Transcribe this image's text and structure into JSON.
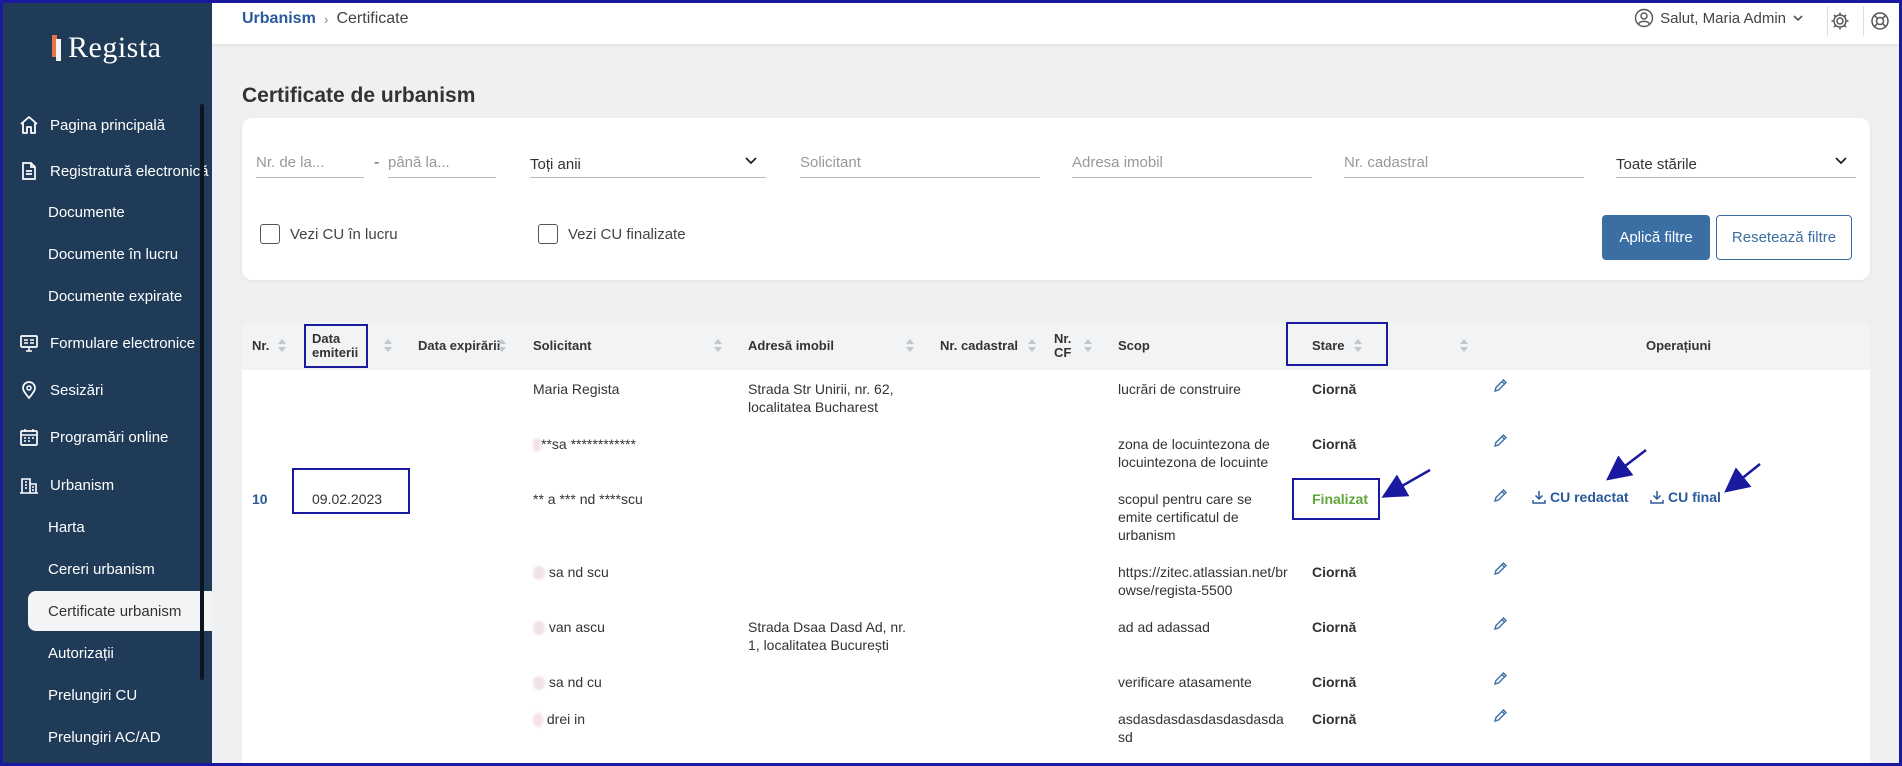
{
  "sidebar": {
    "logo": "Regista",
    "items": [
      {
        "label": "Pagina principală"
      },
      {
        "label": "Registratură electronică"
      },
      {
        "label": "Formulare electronice"
      },
      {
        "label": "Sesizări"
      },
      {
        "label": "Programări online"
      },
      {
        "label": "Urbanism"
      }
    ],
    "registry_sub": [
      {
        "label": "Documente"
      },
      {
        "label": "Documente în lucru"
      },
      {
        "label": "Documente expirate"
      }
    ],
    "urbanism_sub": [
      {
        "label": "Harta"
      },
      {
        "label": "Cereri urbanism"
      },
      {
        "label": "Certificate urbanism"
      },
      {
        "label": "Autorizații"
      },
      {
        "label": "Prelungiri CU"
      },
      {
        "label": "Prelungiri AC/AD"
      }
    ]
  },
  "header": {
    "breadcrumb_parent": "Urbanism",
    "breadcrumb_current": "Certificate",
    "user_greeting": "Salut, Maria Admin"
  },
  "page": {
    "title": "Certificate de urbanism"
  },
  "filters": {
    "nr_from_placeholder": "Nr. de la...",
    "nr_to_placeholder": "până la...",
    "dash": "-",
    "year_select": "Toți anii",
    "applicant_placeholder": "Solicitant",
    "address_placeholder": "Adresa imobil",
    "cadastral_placeholder": "Nr. cadastral",
    "status_select": "Toate stările",
    "cb_in_work": "Vezi CU în lucru",
    "cb_finalized": "Vezi CU finalizate",
    "apply_label": "Aplică filtre",
    "reset_label": "Resetează filtre"
  },
  "table": {
    "columns": {
      "nr": "Nr.",
      "issue_date": "Data emiterii",
      "expiry_date": "Data expirării",
      "applicant": "Solicitant",
      "address": "Adresă imobil",
      "cadastral": "Nr. cadastral",
      "cf": "Nr. CF",
      "purpose": "Scop",
      "status": "Stare",
      "operations": "Operațiuni"
    },
    "rows": [
      {
        "nr": "",
        "issue_date": "",
        "applicant": "Maria Regista",
        "address": "Strada Str Unirii, nr. 62, localitatea Bucharest",
        "purpose": "lucrări de construire",
        "status": "Ciornă"
      },
      {
        "nr": "",
        "issue_date": "",
        "applicant": "**sa ************",
        "address": "",
        "purpose": "zona de locuintezona de locuintezona de locuinte",
        "status": "Ciornă"
      },
      {
        "nr": "10",
        "issue_date": "09.02.2023",
        "applicant": "** a *** nd ****scu",
        "address": "",
        "purpose": "scopul pentru care se emite certificatul de urbanism",
        "status": "Finalizat"
      },
      {
        "nr": "",
        "issue_date": "",
        "applicant": "sa  nd  scu",
        "address": "",
        "purpose": "https://zitec.atlassian.net/browse/regista-5500",
        "status": "Ciornă"
      },
      {
        "nr": "",
        "issue_date": "",
        "applicant": "van  ascu",
        "address": "Strada Dsaa Dasd Ad, nr. 1, localitatea București",
        "purpose": "ad ad adassad",
        "status": "Ciornă"
      },
      {
        "nr": "",
        "issue_date": "",
        "applicant": "sa  nd  cu",
        "address": "",
        "purpose": "verificare atasamente",
        "status": "Ciornă"
      },
      {
        "nr": "",
        "issue_date": "",
        "applicant": "drei  in",
        "address": "",
        "purpose": "asdasdasdasdasdasdasdasd",
        "status": "Ciornă"
      }
    ],
    "op_draft": "CU redactat",
    "op_final": "CU final"
  },
  "colors": {
    "sidebar": "#1f3b57",
    "accent": "#3b6fa3",
    "finalized": "#5fa53a",
    "annotation": "#1a1aa0"
  }
}
